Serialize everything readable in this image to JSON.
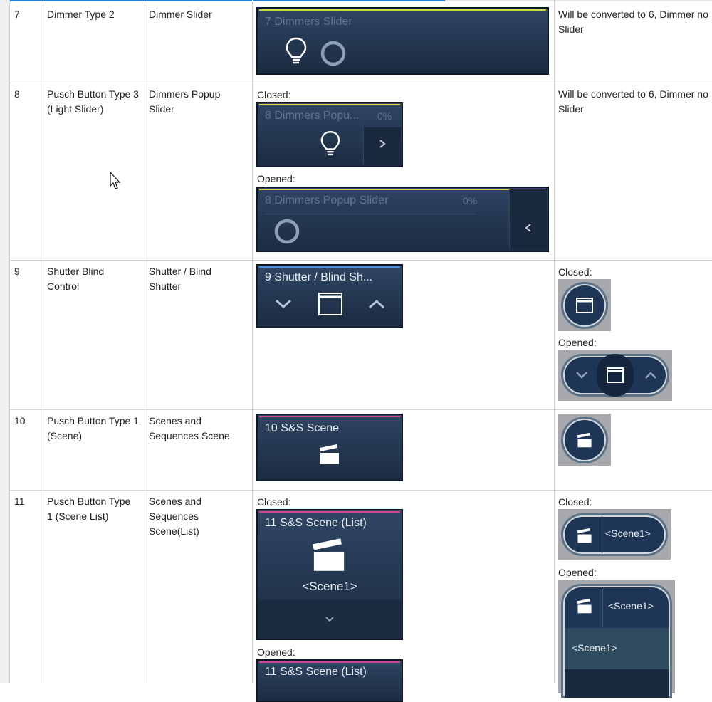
{
  "labels": {
    "closed": "Closed:",
    "opened": "Opened:"
  },
  "rows": [
    {
      "num": "7",
      "original": "Dimmer Type 2",
      "target": "Dimmer Slider",
      "note": "Will be converted to 6, Dimmer no Slider",
      "tile": {
        "title": "7 Dimmers Slider"
      }
    },
    {
      "num": "8",
      "original": "Pusch Button Type 3 (Light Slider)",
      "target": "Dimmers Popup Slider",
      "note": "Will be converted to 6, Dimmer no Slider",
      "closed_tile": {
        "title": "8 Dimmers Popu...",
        "percent": "0%"
      },
      "opened_tile": {
        "title": "8 Dimmers Popup  Slider",
        "percent": "0%"
      }
    },
    {
      "num": "9",
      "original": "Shutter Blind Control",
      "target": "Shutter / Blind Shutter",
      "tile": {
        "title": "9 Shutter / Blind Sh..."
      }
    },
    {
      "num": "10",
      "original": "Pusch Button Type 1 (Scene)",
      "target": "Scenes and Sequences Scene",
      "tile": {
        "title": "10 S&S Scene"
      }
    },
    {
      "num": "11",
      "original": "Pusch Button Type 1 (Scene List)",
      "target": "Scenes and Sequences Scene(List)",
      "closed_tile": {
        "title": "11 S&S Scene (List)",
        "scene": "<Scene1>"
      },
      "opened_tile": {
        "title": "11 S&S Scene (List)"
      },
      "closed_pill": {
        "scene": "<Scene1>"
      },
      "opened_panel": {
        "scene": "<Scene1>",
        "list_item": "<Scene1>"
      }
    }
  ],
  "colors": {
    "tile_bg": "#243852",
    "strip_yellow": "#d7d64a",
    "strip_blue": "#4f8fe0",
    "strip_pink": "#d0478f",
    "frame_gray": "#a7a9ac"
  },
  "icons": [
    "lightbulb-icon",
    "circle-icon",
    "chevron-right-icon",
    "chevron-left-icon",
    "chevron-down-icon",
    "chevron-up-icon",
    "window-shutter-icon",
    "clapperboard-icon",
    "mouse-cursor-icon"
  ]
}
